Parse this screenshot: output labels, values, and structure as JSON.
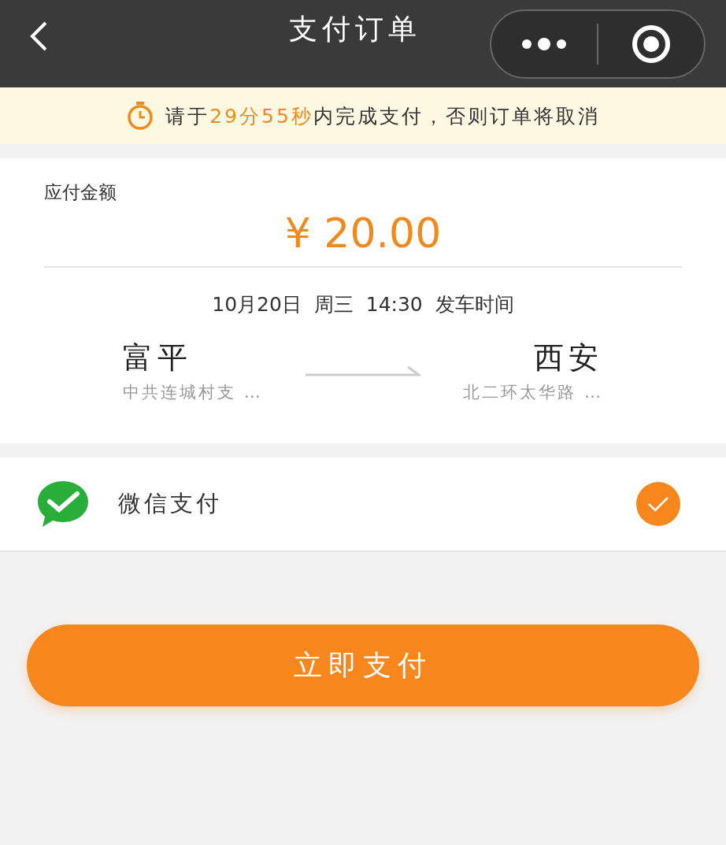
{
  "nav_bar": {
    "title": "支付订单"
  },
  "countdown_banner": {
    "text_before": "请于",
    "time": "29分55秒",
    "text_after": "内完成支付，否则订单将取消"
  },
  "order": {
    "amount_label": "应付金额",
    "amount": "¥ 20.00",
    "departure": "10月20日  周三  14:30  发车时间",
    "from": {
      "city": "富平",
      "station": "中共连城村支 …"
    },
    "to": {
      "city": "西安",
      "station": "北二环太华路 …"
    }
  },
  "payment_methods": [
    {
      "label": "微信支付",
      "selected": true
    }
  ],
  "pay_button": "立即支付"
}
